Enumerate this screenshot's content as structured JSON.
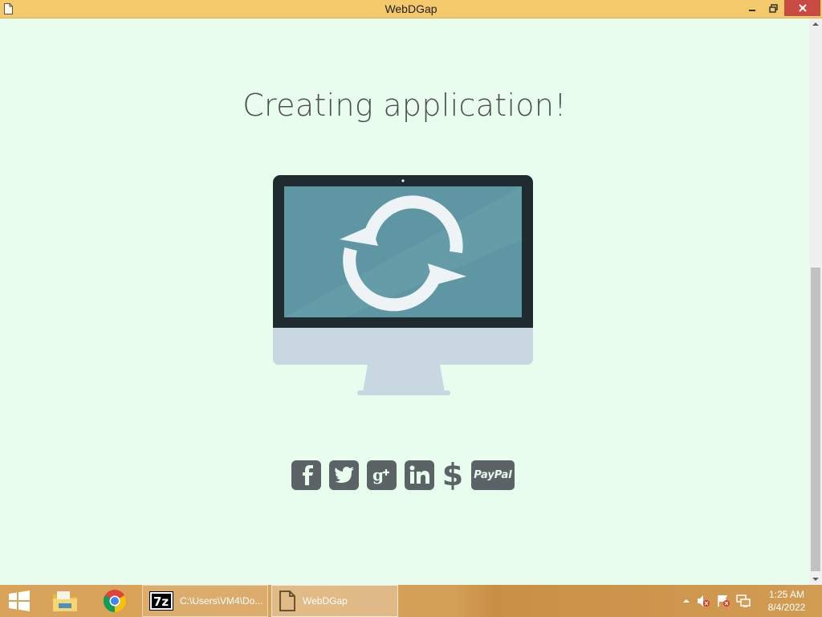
{
  "window": {
    "title": "WebDGap",
    "app_icon": "document-icon",
    "controls": [
      "minimize-icon",
      "restore-icon",
      "close-icon"
    ],
    "close_color": "#c74a43",
    "titlebar_color": "#f3c96b"
  },
  "main": {
    "headline": "Creating application!",
    "illustration": {
      "type": "monitor",
      "screen_icon": "refresh-icon",
      "screen_color": "#5f96a3",
      "bezel_color": "#202b2f",
      "base_color": "#c8d7e1"
    },
    "social_links": [
      {
        "name": "facebook-icon",
        "glyph": "f"
      },
      {
        "name": "twitter-icon",
        "glyph": ""
      },
      {
        "name": "google-plus-icon",
        "glyph": "g+"
      },
      {
        "name": "linkedin-icon",
        "glyph": "in"
      },
      {
        "name": "dollar-icon",
        "glyph": "$"
      },
      {
        "name": "paypal-icon",
        "label": "PayPal"
      }
    ],
    "icon_color": "#5c6367",
    "background": "#e9fdef"
  },
  "taskbar": {
    "start_icon": "windows-start-icon",
    "pinned": [
      "file-explorer-icon",
      "chrome-icon"
    ],
    "tasks": [
      {
        "icon": "7zip-icon",
        "label": "C:\\Users\\VM4\\Do...",
        "active": false
      },
      {
        "icon": "document-icon",
        "label": "WebDGap",
        "active": true
      }
    ],
    "tray_icons": [
      "show-hidden-icons-icon",
      "volume-muted-icon",
      "action-center-icon",
      "network-icon"
    ],
    "clock": {
      "time": "1:25 AM",
      "date": "8/4/2022"
    }
  }
}
